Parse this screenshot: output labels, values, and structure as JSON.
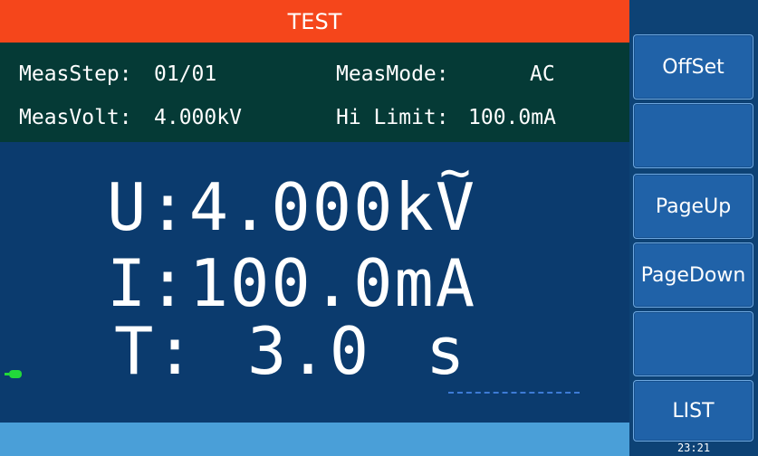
{
  "header": {
    "title": "TEST"
  },
  "info": {
    "meas_step_label": "MeasStep:",
    "meas_step_value": "01/01",
    "meas_mode_label": "MeasMode:",
    "meas_mode_value": "AC",
    "meas_volt_label": "MeasVolt:",
    "meas_volt_value": "4.000kV",
    "hi_limit_label": "Hi Limit:",
    "hi_limit_value": "100.0mA"
  },
  "readings": {
    "voltage_prefix": "U:4.000k",
    "voltage_unit": "V",
    "current": "I:100.0mA",
    "time_label": "T:",
    "time_value": "3.0",
    "time_unit": "s"
  },
  "softkeys": [
    {
      "label": "OffSet"
    },
    {
      "label": ""
    },
    {
      "label": "PageUp"
    },
    {
      "label": "PageDown"
    },
    {
      "label": ""
    },
    {
      "label": "LIST"
    }
  ],
  "status": {
    "clock": "23:21"
  },
  "colors": {
    "title_bar": "#f5461b",
    "info_panel": "#053a36",
    "main_panel": "#0b3b6e",
    "softkey": "#2062a8",
    "status_bar": "#4a9fd8",
    "indicator": "#22d83a"
  },
  "icons": {
    "connection_indicator": "plug-icon"
  }
}
